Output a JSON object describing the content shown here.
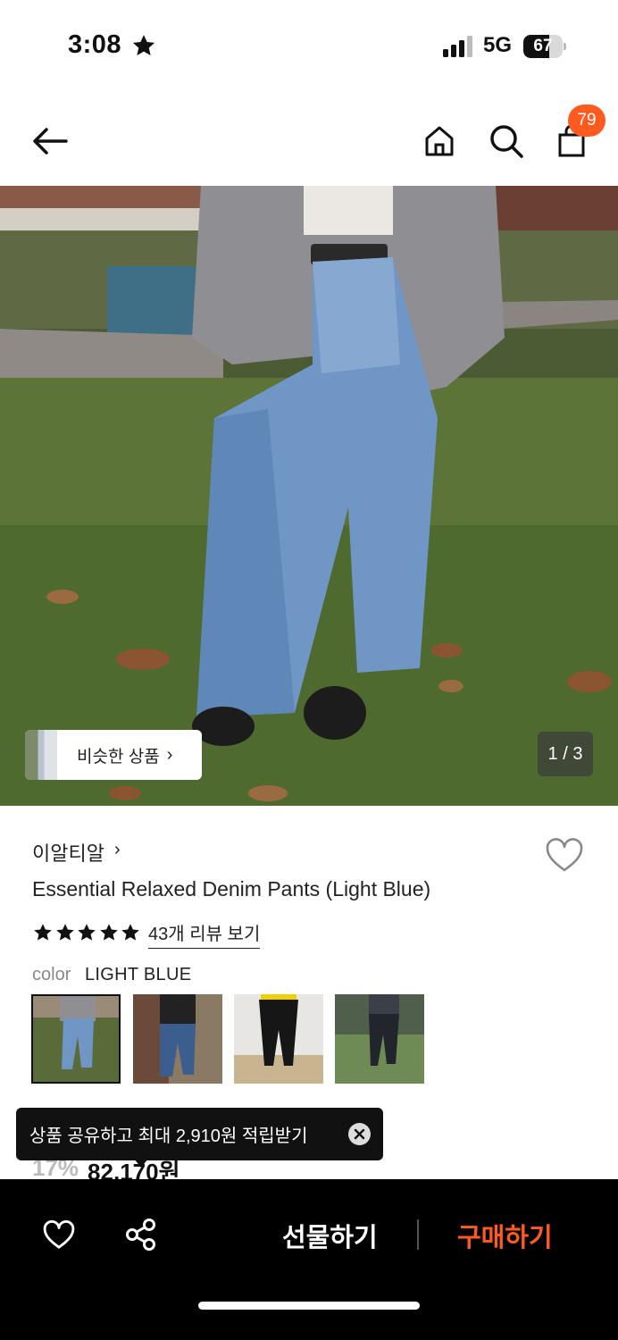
{
  "status_bar": {
    "time": "3:08",
    "network": "5G",
    "battery": "67",
    "battery_level": 0.67
  },
  "nav": {
    "cart_count": "79"
  },
  "hero": {
    "similar_label": "비슷한 상품",
    "page_indicator": "1 / 3"
  },
  "product": {
    "brand": "이알티알",
    "name": "Essential Relaxed Denim Pants (Light Blue)",
    "rating_stars": 5,
    "review_link": "43개 리뷰 보기",
    "color_label": "color",
    "color_value": "LIGHT BLUE",
    "discount": "17%",
    "price": "82,170원"
  },
  "toast": {
    "text": "상품 공유하고 최대 2,910원 적립받기"
  },
  "bottom_bar": {
    "gift_label": "선물하기",
    "buy_label": "구매하기"
  },
  "colors": {
    "accent": "#ff5a1f",
    "bottom_bar_bg": "#000000"
  }
}
